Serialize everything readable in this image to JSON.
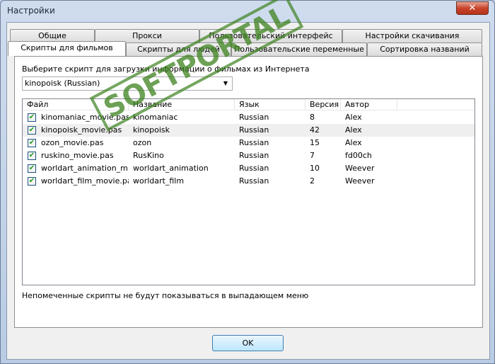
{
  "window": {
    "title": "Настройки",
    "close_label": "✕"
  },
  "tabs_row1": [
    {
      "label": "Общие"
    },
    {
      "label": "Прокси"
    },
    {
      "label": "Пользовательский интерфейс"
    },
    {
      "label": "Настройки скачивания"
    }
  ],
  "tabs_row2": [
    {
      "label": "Скрипты для фильмов",
      "selected": true
    },
    {
      "label": "Скрипты для людей"
    },
    {
      "label": "Пользовательские переменные"
    },
    {
      "label": "Сортировка названий"
    }
  ],
  "script_label": "Выберите скрипт для загрузки информации о фильмах из Интернета",
  "script_select": {
    "value": "kinopoisk (Russian)"
  },
  "list": {
    "columns": [
      "Файл",
      "Название",
      "Язык",
      "Версия",
      "Автор"
    ],
    "rows": [
      {
        "checked": true,
        "file": "kinomaniac_movie.pas",
        "name": "kinomaniac",
        "lang": "Russian",
        "version": "8",
        "author": "Alex"
      },
      {
        "checked": true,
        "file": "kinopoisk_movie.pas",
        "name": "kinopoisk",
        "lang": "Russian",
        "version": "42",
        "author": "Alex"
      },
      {
        "checked": true,
        "file": "ozon_movie.pas",
        "name": "ozon",
        "lang": "Russian",
        "version": "15",
        "author": "Alex"
      },
      {
        "checked": true,
        "file": "ruskino_movie.pas",
        "name": "RusKino",
        "lang": "Russian",
        "version": "7",
        "author": "fd00ch"
      },
      {
        "checked": true,
        "file": "worldart_animation_m...",
        "name": "worldart_animation",
        "lang": "Russian",
        "version": "10",
        "author": "Weever"
      },
      {
        "checked": true,
        "file": "worldart_film_movie.pas",
        "name": "worldart_film",
        "lang": "Russian",
        "version": "2",
        "author": "Weever"
      }
    ]
  },
  "note": "Непомеченные скрипты не будут показываться в выпадающем меню",
  "ok_label": "OK",
  "watermark": "SOFTPORTAL www.softportal.com"
}
